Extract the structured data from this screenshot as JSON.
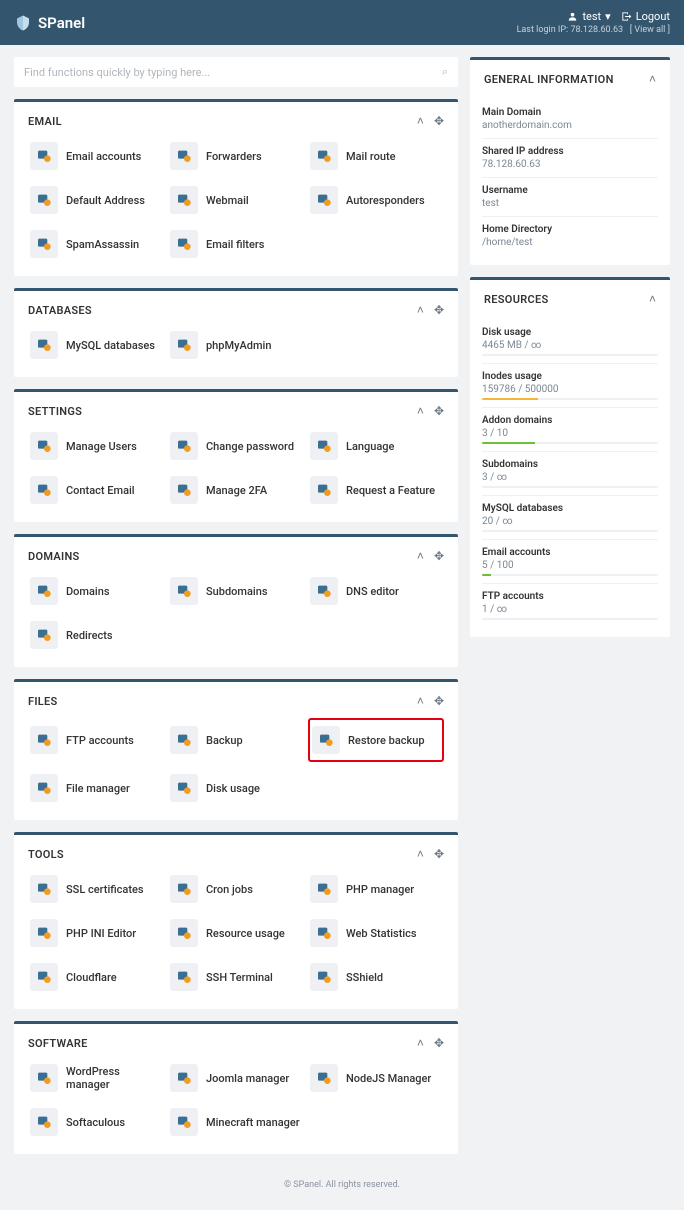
{
  "brand": "SPanel",
  "header": {
    "user": "test",
    "logout": "Logout",
    "last_login_prefix": "Last login IP:",
    "last_login_ip": "78.128.60.63",
    "view_all": "[ View all ]"
  },
  "search": {
    "placeholder": "Find functions quickly by typing here..."
  },
  "panels": {
    "email": {
      "title": "EMAIL",
      "items": [
        "Email accounts",
        "Forwarders",
        "Mail route",
        "Default Address",
        "Webmail",
        "Autoresponders",
        "SpamAssassin",
        "Email filters"
      ]
    },
    "databases": {
      "title": "DATABASES",
      "items": [
        "MySQL databases",
        "phpMyAdmin"
      ]
    },
    "settings": {
      "title": "SETTINGS",
      "items": [
        "Manage Users",
        "Change password",
        "Language",
        "Contact Email",
        "Manage 2FA",
        "Request a Feature"
      ]
    },
    "domains": {
      "title": "DOMAINS",
      "items": [
        "Domains",
        "Subdomains",
        "DNS editor",
        "Redirects"
      ]
    },
    "files": {
      "title": "FILES",
      "items": [
        "FTP accounts",
        "Backup",
        "Restore backup",
        "File manager",
        "Disk usage"
      ]
    },
    "tools": {
      "title": "TOOLS",
      "items": [
        "SSL certificates",
        "Cron jobs",
        "PHP manager",
        "PHP INI Editor",
        "Resource usage",
        "Web Statistics",
        "Cloudflare",
        "SSH Terminal",
        "SShield"
      ]
    },
    "software": {
      "title": "SOFTWARE",
      "items": [
        "WordPress manager",
        "Joomla manager",
        "NodeJS Manager",
        "Softaculous",
        "Minecraft manager"
      ]
    }
  },
  "general_info": {
    "title": "GENERAL INFORMATION",
    "rows": [
      {
        "label": "Main Domain",
        "value": "anotherdomain.com"
      },
      {
        "label": "Shared IP address",
        "value": "78.128.60.63"
      },
      {
        "label": "Username",
        "value": "test"
      },
      {
        "label": "Home Directory",
        "value": "/home/test"
      }
    ]
  },
  "resources": {
    "title": "RESOURCES",
    "rows": [
      {
        "label": "Disk usage",
        "value": "4465 MB / ∞",
        "pct": 0,
        "color": "#6fbf3b"
      },
      {
        "label": "Inodes usage",
        "value": "159786 / 500000",
        "pct": 32,
        "color": "#f2b736"
      },
      {
        "label": "Addon domains",
        "value": "3 / 10",
        "pct": 30,
        "color": "#6fbf3b"
      },
      {
        "label": "Subdomains",
        "value": "3 / ∞",
        "pct": 0,
        "color": "#6fbf3b"
      },
      {
        "label": "MySQL databases",
        "value": "20 / ∞",
        "pct": 0,
        "color": "#6fbf3b"
      },
      {
        "label": "Email accounts",
        "value": "5 / 100",
        "pct": 5,
        "color": "#6fbf3b"
      },
      {
        "label": "FTP accounts",
        "value": "1 / ∞",
        "pct": 0,
        "color": "#6fbf3b"
      }
    ]
  },
  "footer": "© SPanel. All rights reserved."
}
